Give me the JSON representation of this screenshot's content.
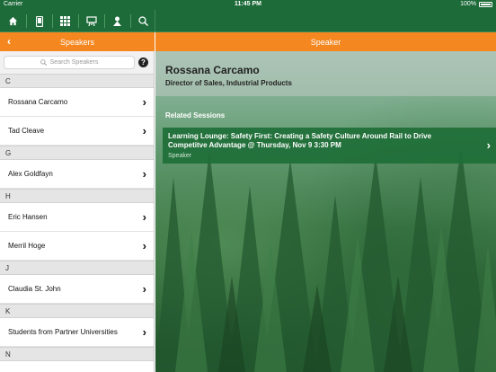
{
  "status_bar": {
    "carrier": "Carrier",
    "time": "11:45 PM",
    "battery": "100%"
  },
  "toolbar": {
    "icons": [
      "home-icon",
      "phone-icon",
      "grid-icon",
      "presentation-icon",
      "map-pin-icon",
      "search-icon"
    ]
  },
  "left_header": {
    "title": "Speakers"
  },
  "right_header": {
    "title": "Speaker"
  },
  "search": {
    "placeholder": "Search Speakers",
    "help_label": "?"
  },
  "speakers": {
    "sections": [
      {
        "letter": "C",
        "names": [
          "Rossana Carcamo",
          "Tad Cleave"
        ]
      },
      {
        "letter": "G",
        "names": [
          "Alex Goldfayn"
        ]
      },
      {
        "letter": "H",
        "names": [
          "Eric Hansen",
          "Merril Hoge"
        ]
      },
      {
        "letter": "J",
        "names": [
          "Claudia St. John"
        ]
      },
      {
        "letter": "K",
        "names": [
          "Students from Partner Universities"
        ]
      },
      {
        "letter": "N",
        "names": []
      }
    ]
  },
  "speaker_detail": {
    "name": "Rossana Carcamo",
    "title": "Director of Sales, Industrial Products",
    "related_label": "Related Sessions",
    "sessions": [
      {
        "title": "Learning Lounge: Safety First: Creating a Safety Culture Around Rail to Drive Competitve Advantage @ Thursday, Nov 9 3:30 PM",
        "role": "Speaker"
      }
    ]
  },
  "colors": {
    "toolbar_green": "#1e6b3a",
    "header_orange": "#f4871f",
    "session_green": "#1e6e37"
  }
}
